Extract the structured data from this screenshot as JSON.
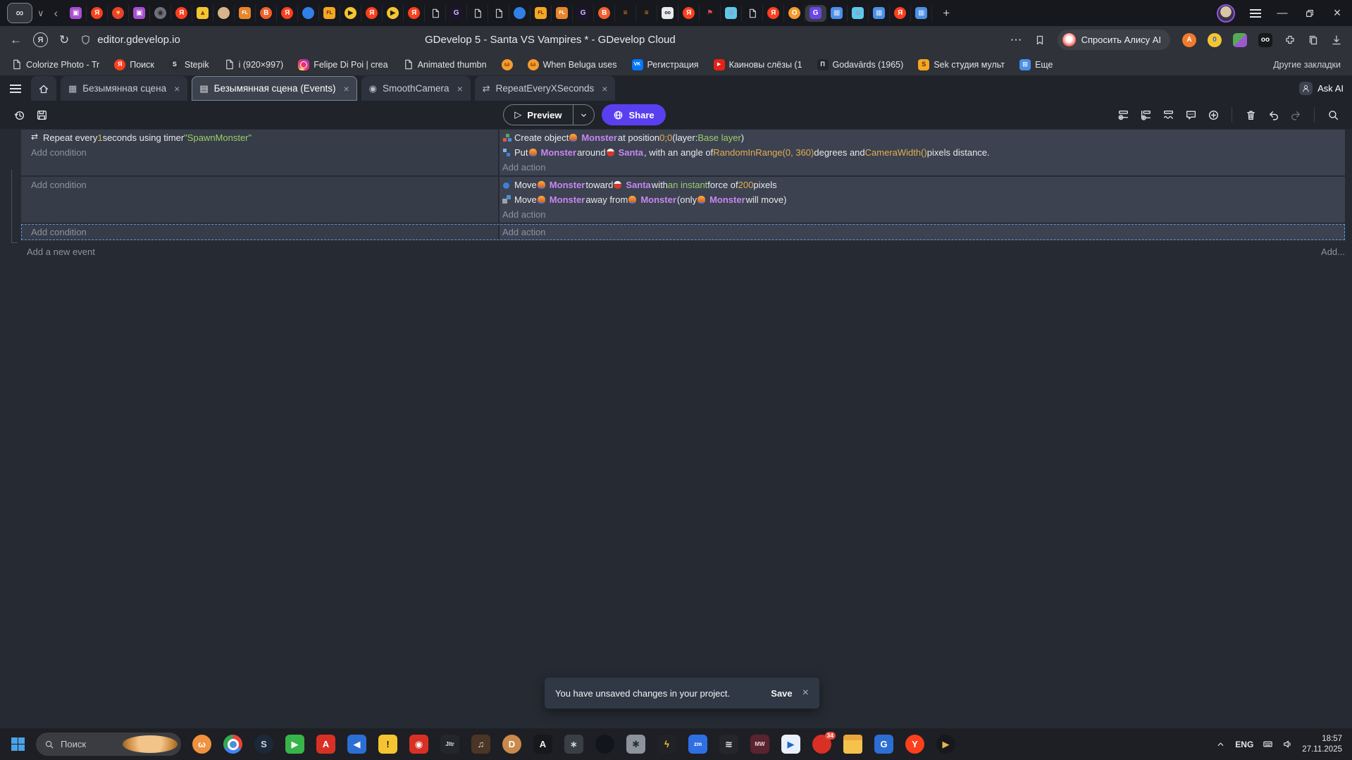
{
  "browser": {
    "tabstrip": {
      "active_tab": {
        "glyph": "∞"
      },
      "tab_list_chevron": "∨",
      "scroll_back": "‹",
      "new_tab_plus": "+",
      "window_controls": {
        "minimize": "—",
        "close": "×"
      },
      "favicons": [
        {
          "bg": "#a84fd0",
          "g": "▣"
        },
        {
          "bg": "#fc3f1d",
          "g": "Я",
          "r": "50%"
        },
        {
          "bg": "#e8422c",
          "g": "♥",
          "fg": "#ffd24d",
          "r": "50%"
        },
        {
          "bg": "#a84fd0",
          "g": "▣"
        },
        {
          "bg": "#6d7077",
          "g": "◉",
          "fg": "#2a2a2a",
          "r": "50%"
        },
        {
          "bg": "#fc3f1d",
          "g": "Я",
          "r": "50%"
        },
        {
          "bg": "#f5c531",
          "g": "▲",
          "fg": "#7a4b12"
        },
        {
          "bg": "#d9b38c",
          "g": "",
          "r": "50%"
        },
        {
          "bg": "#e8862c",
          "g": "FL",
          "small": true
        },
        {
          "bg": "#f15f2c",
          "g": "B",
          "r": "50%"
        },
        {
          "bg": "#fc3f1d",
          "g": "Я",
          "r": "50%"
        },
        {
          "bg": "#2f81e8",
          "g": "",
          "r": "50%"
        },
        {
          "bg": "#f5a623",
          "g": "FL",
          "small": true,
          "fg": "#5a3208"
        },
        {
          "bg": "#f5c531",
          "g": "▶",
          "fg": "#1c1c1c",
          "r": "50%"
        },
        {
          "bg": "#fc3f1d",
          "g": "Я",
          "r": "50%"
        },
        {
          "bg": "#f5c531",
          "g": "▶",
          "fg": "#1c1c1c",
          "r": "50%"
        },
        {
          "bg": "#fc3f1d",
          "g": "Я",
          "r": "50%"
        },
        {
          "doc": true
        },
        {
          "bg": "#1e1430",
          "g": "G",
          "fg": "#cfc4ee"
        },
        {
          "doc": true
        },
        {
          "doc": true
        },
        {
          "bg": "#2f81e8",
          "g": "",
          "r": "50%"
        },
        {
          "bg": "#f5a623",
          "g": "FL",
          "small": true,
          "fg": "#5a3208"
        },
        {
          "bg": "#e8862c",
          "g": "FL",
          "small": true
        },
        {
          "bg": "#1e1430",
          "g": "G",
          "fg": "#cfc4ee"
        },
        {
          "bg": "#f15f2c",
          "g": "B",
          "r": "50%"
        },
        {
          "bg": "transparent",
          "g": "≡",
          "fg": "#f08a1d"
        },
        {
          "bg": "transparent",
          "g": "≡",
          "fg": "#f08a1d"
        },
        {
          "bg": "#e8eaed",
          "g": "oo",
          "fg": "#17181c",
          "small": true
        },
        {
          "bg": "#fc3f1d",
          "g": "Я",
          "r": "50%"
        },
        {
          "bg": "transparent",
          "g": "⚑",
          "fg": "#e84b5a"
        },
        {
          "bg": "#5ec8e8",
          "g": "☺",
          "fg": "#e8568a"
        },
        {
          "doc": true
        },
        {
          "bg": "#fc3f1d",
          "g": "Я",
          "r": "50%"
        },
        {
          "bg": "#f59b2d",
          "g": "O",
          "r": "50%"
        },
        {
          "bg": "#6b46e8",
          "g": "G",
          "active": true
        },
        {
          "bg": "#4a90e8",
          "g": "▦",
          "fg": "#cfe2fb"
        },
        {
          "bg": "#5ec8e8",
          "g": "☺",
          "fg": "#e8568a"
        },
        {
          "bg": "#4a90e8",
          "g": "▦",
          "fg": "#cfe2fb"
        },
        {
          "bg": "#fc3f1d",
          "g": "Я",
          "r": "50%"
        },
        {
          "bg": "#4a90e8",
          "g": "▦",
          "fg": "#cfe2fb"
        }
      ]
    },
    "addressbar": {
      "back_glyph": "←",
      "yandex_glyph": "Я",
      "refresh_glyph": "↻",
      "url": "editor.gdevelop.io",
      "page_title": "GDevelop 5 - Santa VS Vampires * - GDevelop Cloud",
      "more_glyph": "⋯",
      "alice_button": "Спросить Алису AI",
      "extensions": [
        {
          "bg": "#f07a2e",
          "g": "A",
          "r": "50%"
        },
        {
          "bg": "#f5c531",
          "g": "0",
          "fg": "#2b6fd4",
          "r": "50%"
        },
        {
          "bg": "linear-gradient(135deg,#57a956 0 50%,#9b59d0 50%)",
          "g": ""
        },
        {
          "bg": "#17181c",
          "g": "oo",
          "fg": "#fff"
        }
      ]
    },
    "bookmarks": {
      "items": [
        {
          "type": "doc",
          "label": "Colorize Photo - Tr"
        },
        {
          "type": "chip",
          "bg": "#fc3f1d",
          "fg": "#fff",
          "g": "Я",
          "r": "50%",
          "label": "Поиск"
        },
        {
          "type": "chip",
          "bg": "#2b2d33",
          "fg": "#e8eaed",
          "g": "S",
          "r": "50%",
          "label": "Stepik"
        },
        {
          "type": "doc",
          "label": "i (920×997)"
        },
        {
          "type": "ig",
          "label": "Felipe Di Poi | crea"
        },
        {
          "type": "doc",
          "label": "Animated thumbn"
        },
        {
          "type": "chip",
          "bg": "#f59b2d",
          "fg": "#7a3c10",
          "g": "ω",
          "r": "50%",
          "label": ""
        },
        {
          "type": "chip",
          "bg": "#f59b2d",
          "fg": "#7a3c10",
          "g": "ω",
          "r": "50%",
          "label": "When Beluga uses"
        },
        {
          "type": "chip",
          "bg": "#0077ff",
          "fg": "#fff",
          "g": "VK",
          "small": true,
          "label": "Регистрация"
        },
        {
          "type": "yt",
          "label": "Каиновы слёзы (1"
        },
        {
          "type": "chip",
          "bg": "#23252b",
          "fg": "#e8eaed",
          "g": "П",
          "label": "Godavārds (1965)"
        },
        {
          "type": "chip",
          "bg": "#f5a623",
          "fg": "#5a3208",
          "g": "S",
          "label": "Sek студия мульт"
        },
        {
          "type": "chip",
          "bg": "#4a90e8",
          "fg": "#fff",
          "g": "⊞",
          "label": "Еще"
        }
      ],
      "other_label": "Другие закладки"
    }
  },
  "gdevelop": {
    "tabs": [
      {
        "icon": "▦",
        "name": "tab-scene",
        "label": "Безымянная сцена",
        "close": "×"
      },
      {
        "icon": "▤",
        "name": "tab-scene-events",
        "label": "Безымянная сцена (Events)",
        "close": "×",
        "active": true
      },
      {
        "icon": "◉",
        "name": "tab-smoothcamera",
        "label": "SmoothCamera",
        "close": "×"
      },
      {
        "icon": "⇄",
        "name": "tab-repeateveryxseconds",
        "label": "RepeatEveryXSeconds",
        "close": "×"
      }
    ],
    "ask_ai": "Ask AI",
    "toolbar": {
      "preview_label": "Preview",
      "preview_glyph": "▷",
      "share_label": "Share",
      "right_icons": [
        "add-event",
        "add-subevent",
        "add-other",
        "comment",
        "plus-circle",
        "div",
        "trash",
        "undo",
        "redo",
        "div",
        "search"
      ]
    },
    "events": {
      "rows": [
        {
          "cond": [
            {
              "n": "condition-repeat-timer",
              "s": [
                {
                  "i": "repeat"
                },
                {
                  "t": "Repeat every ",
                  "c": "p"
                },
                {
                  "t": "1",
                  "c": "n"
                },
                {
                  "t": " seconds using timer ",
                  "c": "p"
                },
                {
                  "t": "\"SpawnMonster\"",
                  "c": "s"
                }
              ]
            },
            {
              "n": "add-condition-button",
              "s": [
                {
                  "t": "Add condition",
                  "c": "d"
                }
              ]
            }
          ],
          "act": [
            {
              "n": "action-create-object",
              "s": [
                {
                  "i": "create"
                },
                {
                  "t": "Create object ",
                  "c": "p"
                },
                {
                  "i": "monster"
                },
                {
                  "t": "Monster",
                  "c": "o"
                },
                {
                  "t": " at position ",
                  "c": "p"
                },
                {
                  "t": "0;0",
                  "c": "n"
                },
                {
                  "t": " (layer: ",
                  "c": "p"
                },
                {
                  "t": "Base layer",
                  "c": "s"
                },
                {
                  "t": ")",
                  "c": "p"
                }
              ]
            },
            {
              "n": "action-put-around",
              "s": [
                {
                  "i": "put"
                },
                {
                  "t": "Put ",
                  "c": "p"
                },
                {
                  "i": "monster"
                },
                {
                  "t": "Monster",
                  "c": "o"
                },
                {
                  "t": " around ",
                  "c": "p"
                },
                {
                  "i": "santa"
                },
                {
                  "t": "Santa",
                  "c": "o"
                },
                {
                  "t": ", with an angle of ",
                  "c": "p"
                },
                {
                  "t": "RandomInRange(0, 360)",
                  "c": "n"
                },
                {
                  "t": " degrees and ",
                  "c": "p"
                },
                {
                  "t": "CameraWidth()",
                  "c": "n"
                },
                {
                  "t": " pixels distance.",
                  "c": "p"
                }
              ]
            },
            {
              "n": "add-action-button",
              "s": [
                {
                  "t": "Add action",
                  "c": "d"
                }
              ]
            }
          ]
        },
        {
          "cond": [
            {
              "n": "add-condition-button",
              "s": [
                {
                  "t": "Add condition",
                  "c": "d"
                }
              ]
            }
          ],
          "act": [
            {
              "n": "action-move-toward",
              "s": [
                {
                  "i": "move"
                },
                {
                  "t": "Move ",
                  "c": "p"
                },
                {
                  "i": "monster"
                },
                {
                  "t": "Monster",
                  "c": "o"
                },
                {
                  "t": " toward ",
                  "c": "p"
                },
                {
                  "i": "santa"
                },
                {
                  "t": "Santa",
                  "c": "o"
                },
                {
                  "t": " with ",
                  "c": "p"
                },
                {
                  "t": "an instant",
                  "c": "s"
                },
                {
                  "t": " force of ",
                  "c": "p"
                },
                {
                  "t": "200",
                  "c": "n"
                },
                {
                  "t": " pixels",
                  "c": "p"
                }
              ]
            },
            {
              "n": "action-move-away",
              "s": [
                {
                  "i": "moveaway"
                },
                {
                  "t": "Move ",
                  "c": "p"
                },
                {
                  "i": "monster"
                },
                {
                  "t": "Monster",
                  "c": "o"
                },
                {
                  "t": " away from ",
                  "c": "p"
                },
                {
                  "i": "monster"
                },
                {
                  "t": "Monster",
                  "c": "o"
                },
                {
                  "t": " (only ",
                  "c": "p"
                },
                {
                  "i": "monster"
                },
                {
                  "t": "Monster",
                  "c": "o"
                },
                {
                  "t": " will move)",
                  "c": "p"
                }
              ]
            },
            {
              "n": "add-action-button",
              "s": [
                {
                  "t": "Add action",
                  "c": "d"
                }
              ]
            }
          ]
        },
        {
          "selected": true,
          "cond": [
            {
              "n": "add-condition-button",
              "s": [
                {
                  "t": "Add condition",
                  "c": "d"
                }
              ]
            }
          ],
          "act": [
            {
              "n": "add-action-button",
              "s": [
                {
                  "t": "Add action",
                  "c": "d"
                }
              ]
            }
          ]
        }
      ],
      "add_new_event": "Add a new event",
      "add_more": "Add...",
      "colors": {
        "object": "#c887f0",
        "number": "#e3af4f",
        "string": "#9ccf68",
        "selection": "#5b9be0"
      }
    },
    "notification": {
      "message": "You have unsaved changes in your project.",
      "save_label": "Save",
      "close_glyph": "×"
    }
  },
  "taskbar": {
    "search_label": "Поиск",
    "apps": [
      {
        "bg": "#f0923e",
        "g": "ω",
        "fg": "#fff",
        "r": "50%",
        "name": "pet-app"
      },
      {
        "cls": "tb-chrome",
        "name": "chrome"
      },
      {
        "bg": "#1b2838",
        "g": "S",
        "fg": "#cfd8e2",
        "r": "50%",
        "name": "steam"
      },
      {
        "bg": "#38b54a",
        "g": "▶",
        "fg": "#fff",
        "name": "green-player"
      },
      {
        "bg": "#d93025",
        "g": "A",
        "fg": "#fff",
        "name": "red-a-app"
      },
      {
        "bg": "#2b6fd4",
        "g": "◀",
        "fg": "#fff",
        "name": "blue-arrow-app"
      },
      {
        "bg": "#f5c531",
        "g": "!",
        "fg": "#1c1c1c",
        "name": "warning-app"
      },
      {
        "bg": "#d93025",
        "g": "◉",
        "fg": "#fff",
        "name": "red-cam-app"
      },
      {
        "bg": "#23262b",
        "g": "Jltr",
        "fg": "#dfe3e8",
        "small": true,
        "name": "jltr-app"
      },
      {
        "bg": "#4a3526",
        "g": "♫",
        "fg": "#e8d9c4",
        "name": "music-app"
      },
      {
        "bg": "#c98a4b",
        "g": "D",
        "fg": "#fff",
        "r": "50%",
        "name": "dog-app"
      },
      {
        "bg": "#17181c",
        "g": "A",
        "fg": "#f2f2f2",
        "name": "dark-a-app"
      },
      {
        "bg": "#3a3f46",
        "g": "∗",
        "fg": "#cfd6de",
        "name": "asterisk-app"
      },
      {
        "bg": "#12151c",
        "g": "",
        "r": "50%",
        "name": "dark-circle-app"
      },
      {
        "bg": "#8c939c",
        "g": "✱",
        "fg": "#2b2e33",
        "name": "settings-gear"
      },
      {
        "bg": "#202227",
        "g": "ϟ",
        "fg": "#f3c52f",
        "name": "light-app"
      },
      {
        "bg": "#2f6fe4",
        "g": "zm",
        "fg": "#fff",
        "small": true,
        "name": "zm-app"
      },
      {
        "bg": "#24262b",
        "g": "≋",
        "fg": "#e8eaee",
        "name": "waves-app"
      },
      {
        "bg": "#5a2330",
        "g": "MW",
        "fg": "#e8d7db",
        "small": true,
        "name": "mw-app"
      },
      {
        "bg": "#e8f0fb",
        "g": "▶",
        "fg": "#1e66d0",
        "name": "blue-play-app"
      },
      {
        "bg": "#d93025",
        "g": "",
        "r": "50%",
        "badge": "34",
        "name": "badged-browser"
      },
      {
        "cls": "tb-folder",
        "name": "file-explorer"
      },
      {
        "bg": "#2b6fd4",
        "g": "G",
        "fg": "#fff",
        "name": "gdevelop-desktop"
      },
      {
        "bg": "#fc3f1d",
        "g": "Y",
        "fg": "#fff",
        "r": "50%",
        "name": "yandex-app"
      },
      {
        "bg": "#17181c",
        "g": "▶",
        "fg": "#e8b64c",
        "r": "50%",
        "name": "media-player"
      }
    ],
    "tray": {
      "lang": "ENG",
      "time": "18:57",
      "date": "27.11.2025"
    }
  }
}
